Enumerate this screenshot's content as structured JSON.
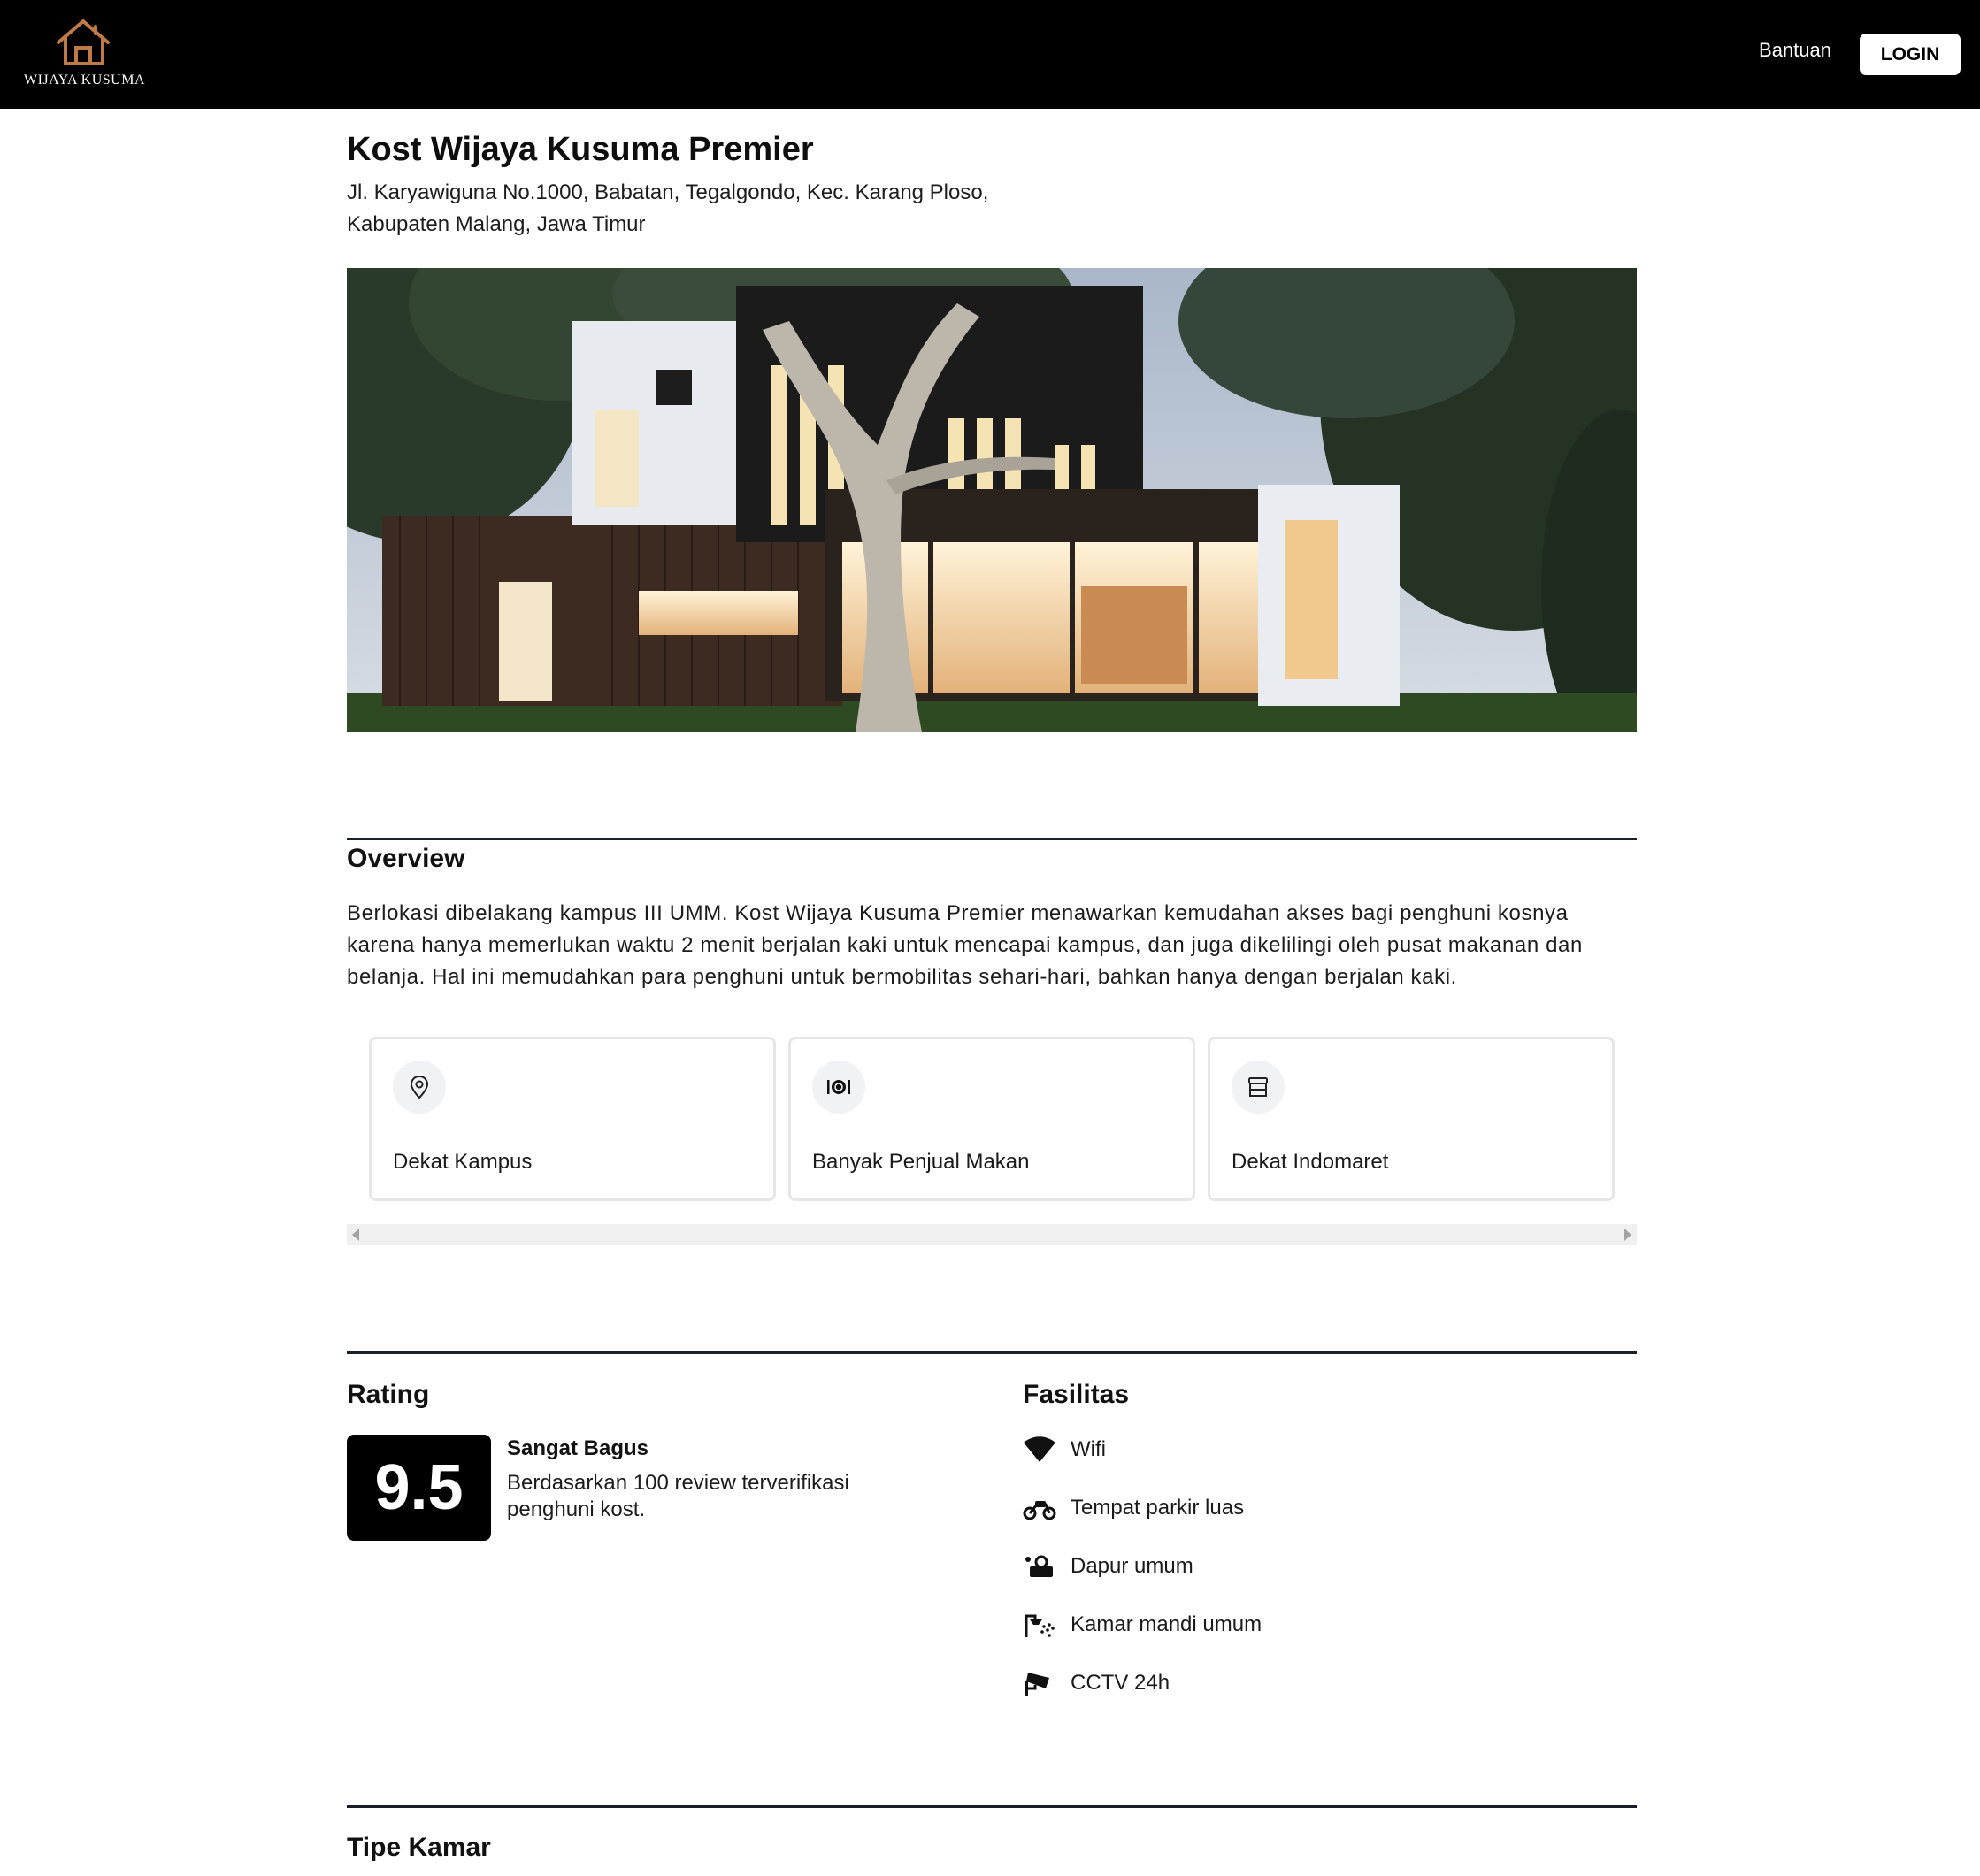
{
  "brand": {
    "name": "WIJAYA KUSUMA",
    "accent": "#c07a45"
  },
  "nav": {
    "help": "Bantuan",
    "login": "LOGIN"
  },
  "property": {
    "title": "Kost Wijaya Kusuma Premier",
    "address": "Jl. Karyawiguna No.1000, Babatan, Tegalgondo, Kec. Karang Ploso, Kabupaten Malang, Jawa Timur"
  },
  "overview": {
    "heading": "Overview",
    "text": "Berlokasi dibelakang kampus III UMM. Kost Wijaya Kusuma Premier menawarkan kemudahan akses bagi penghuni kosnya karena hanya memerlukan waktu 2 menit berjalan kaki untuk mencapai kampus, dan juga dikelilingi oleh pusat makanan dan belanja. Hal ini memudahkan para penghuni untuk bermobilitas sehari-hari, bahkan hanya dengan berjalan kaki.",
    "highlights": [
      {
        "icon": "location-pin-icon",
        "label": "Dekat Kampus"
      },
      {
        "icon": "plate-cutlery-icon",
        "label": "Banyak Penjual Makan"
      },
      {
        "icon": "store-icon",
        "label": "Dekat Indomaret"
      }
    ]
  },
  "rating": {
    "heading": "Rating",
    "score": "9.5",
    "title": "Sangat Bagus",
    "description": "Berdasarkan 100 review terverifikasi penghuni kost."
  },
  "facilities": {
    "heading": "Fasilitas",
    "items": [
      {
        "icon": "wifi-icon",
        "label": "Wifi"
      },
      {
        "icon": "motorcycle-icon",
        "label": "Tempat parkir luas"
      },
      {
        "icon": "kitchen-icon",
        "label": "Dapur umum"
      },
      {
        "icon": "shower-icon",
        "label": "Kamar mandi umum"
      },
      {
        "icon": "cctv-icon",
        "label": "CCTV 24h"
      }
    ]
  },
  "rooms": {
    "heading": "Tipe Kamar"
  }
}
